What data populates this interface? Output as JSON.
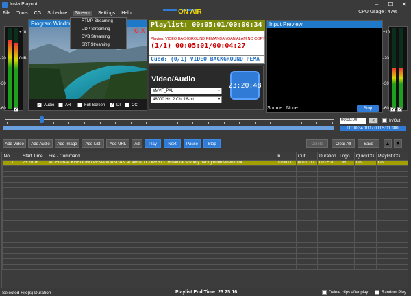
{
  "window": {
    "title": "Insta Playout"
  },
  "menu": {
    "items": [
      {
        "label": "File"
      },
      {
        "label": "Tools"
      },
      {
        "label": "CG"
      },
      {
        "label": "Schedule"
      },
      {
        "label": "Stream"
      },
      {
        "label": "Settings"
      },
      {
        "label": "Help"
      }
    ],
    "stream_dropdown": [
      "RTMP Streaming",
      "UDP Streaming",
      "DVB Streaming",
      "SRT Streaming"
    ]
  },
  "status_header": {
    "on_air": "ON AIR",
    "cpu_usage": "CPU Usage : 47%"
  },
  "vu_scale": [
    "+10",
    "-20",
    "-30",
    "-60"
  ],
  "vu_db": "0dB",
  "program_window": {
    "title": "Program Window",
    "overlay_text": "G X"
  },
  "program_checks": [
    {
      "label": "Audio",
      "checked": true
    },
    {
      "label": "AR",
      "checked": false
    },
    {
      "label": "Full Screen",
      "checked": false
    },
    {
      "label": "DI",
      "checked": true
    },
    {
      "label": "CC",
      "checked": false
    }
  ],
  "playlist": {
    "label": "Playlist: 00:05:01/00:00:34",
    "playing": "Playing: VIDEO BACKGROUND PEMANDANGAN ALAM NO COPY",
    "counter": "(1/1) 00:05:01/00:04:27",
    "cued": "Cued: (0/1) VIDEO BACKGROUND PEMA"
  },
  "video_audio": {
    "title": "Video/Audio",
    "video_format": "eMVF_PAL",
    "audio_format": "48000 Hz, 2 Ch, 16-bit",
    "clock": "23:20:48"
  },
  "input_preview": {
    "title": "Input Preview",
    "source": "Source : None",
    "stop_label": "Stop"
  },
  "input_checks": [
    "0",
    "1",
    "2"
  ],
  "seek": {
    "time_value": "00:00:00",
    "prev_label": "<",
    "in_out_label": "In/Out",
    "readout": "00:00:34.100 / 00:05:01.300",
    "position_fraction": 0.11
  },
  "toolbar": {
    "add_video": "Add Video",
    "add_audio": "Add Audio",
    "add_image": "Add Image",
    "add_list": "Add List",
    "add_url": "Add URL",
    "more": "Ad",
    "play": "Play",
    "next": "Next",
    "pause": "Pause",
    "stop": "Stop",
    "delete": "Delete",
    "clear_all": "Clear All",
    "save": "Save",
    "up": "▲",
    "down": "▼"
  },
  "grid": {
    "columns": [
      "No.",
      "Start Time",
      "File / Command",
      "In",
      "Out",
      "Duration",
      "Logo",
      "QuickCG",
      "Playlist CG"
    ],
    "rows": [
      [
        "1",
        "23:20:16",
        "VIDEO BACKGROUND PEMANDANGAN ALAM NO COPYRIGTH natural scenery background video.mp4",
        "00:00:00",
        "00:00:00",
        "00:05:01",
        "ON",
        "ON",
        "ON"
      ]
    ]
  },
  "status_bar": {
    "selected": "Selected File(s) Duration :",
    "end_time": "Playlist End Time: 23:25:16",
    "delete_after": "Delete clips after play",
    "random": "Random Play"
  }
}
